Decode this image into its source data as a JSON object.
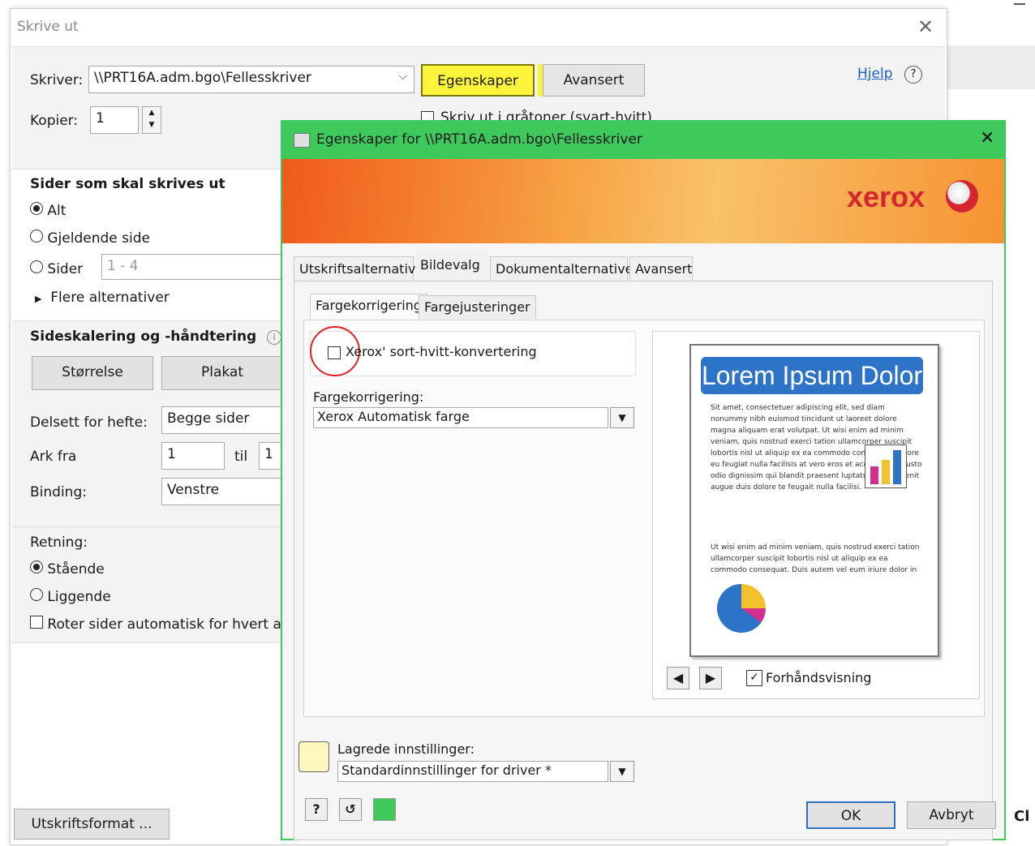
{
  "background": {
    "partial_text": "Cl"
  },
  "print_dialog": {
    "title": "Skrive ut",
    "printer_label": "Skriver:",
    "printer_value": "\\\\PRT16A.adm.bgo\\Fellesskriver",
    "properties_button": "Egenskaper",
    "advanced_button": "Avansert",
    "help_link": "Hjelp",
    "copies_label": "Kopier:",
    "copies_value": "1",
    "grayscale_partial": "Skriv ut i gråtoner (svart-hvitt)",
    "pages_heading": "Sider som skal skrives ut",
    "option_all": "Alt",
    "option_current": "Gjeldende side",
    "option_pages": "Sider",
    "pages_range_value": "1 - 4",
    "more_options": "Flere alternativer",
    "scaling_heading": "Sideskalering og -håndtering",
    "size_button": "Størrelse",
    "poster_button": "Plakat",
    "booklet_label": "Delsett for hefte:",
    "booklet_value": "Begge sider",
    "sheets_label": "Ark fra",
    "sheets_from": "1",
    "sheets_to_label": "til",
    "sheets_to": "1",
    "binding_label": "Binding:",
    "binding_value": "Venstre",
    "orientation_label": "Retning:",
    "portrait": "Stående",
    "landscape": "Liggende",
    "auto_rotate": "Roter sider automatisk for hvert ark",
    "print_format_button": "Utskriftsformat ..."
  },
  "xerox_dialog": {
    "title": "Egenskaper for \\\\PRT16A.adm.bgo\\Fellesskriver",
    "brand": "xerox",
    "tabs": [
      "Utskriftsalternativer",
      "Bildevalg",
      "Dokumentalternativer",
      "Avansert"
    ],
    "subtabs": [
      "Fargekorrigering",
      "Fargejusteringer"
    ],
    "bw_conversion": "Xerox' sort-hvitt-konvertering",
    "color_correction_label": "Fargekorrigering:",
    "color_correction_value": "Xerox Automatisk farge",
    "preview_title": "Lorem Ipsum Dolor",
    "preview_para1": "Sit amet, consectetuer adipiscing elit, sed diam nonummy nibh euismod tincidunt ut laoreet dolore magna aliquam erat volutpat. Ut wisi enim ad minim veniam, quis nostrud exerci tation ullamcorper suscipit lobortis nisl ut aliquip ex ea commodo consequat. Dolore eu feugiat nulla facilisis at vero eros et accumsan et iusto odio dignissim qui blandit praesent luptatum zzril delenit augue duis dolore te feugait nulla facilisi.",
    "preview_para2": "Ut wisi enim ad minim veniam, quis nostrud exerci tation ullamcorper suscipit lobortis nisl ut aliquip ex ea commodo consequat. Duis autem vel eum iriure dolor in hendrerit in vulputate velit esse molestie consequat, vel illum dolore eu feugiat nulla facilisis at vero eros et accumsan et iusto odio dignissim",
    "preview_checkbox": "Forhåndsvisning",
    "saved_settings_label": "Lagrede innstillinger:",
    "saved_settings_value": "Standardinnstillinger for driver *",
    "ok_button": "OK",
    "cancel_button": "Avbryt",
    "help_icon_glyph": "?"
  },
  "colors": {
    "green_title": "#3ec95d",
    "highlight": "#fbf43a",
    "xerox_red": "#d5262f",
    "preview_blue": "#2d74c8"
  }
}
